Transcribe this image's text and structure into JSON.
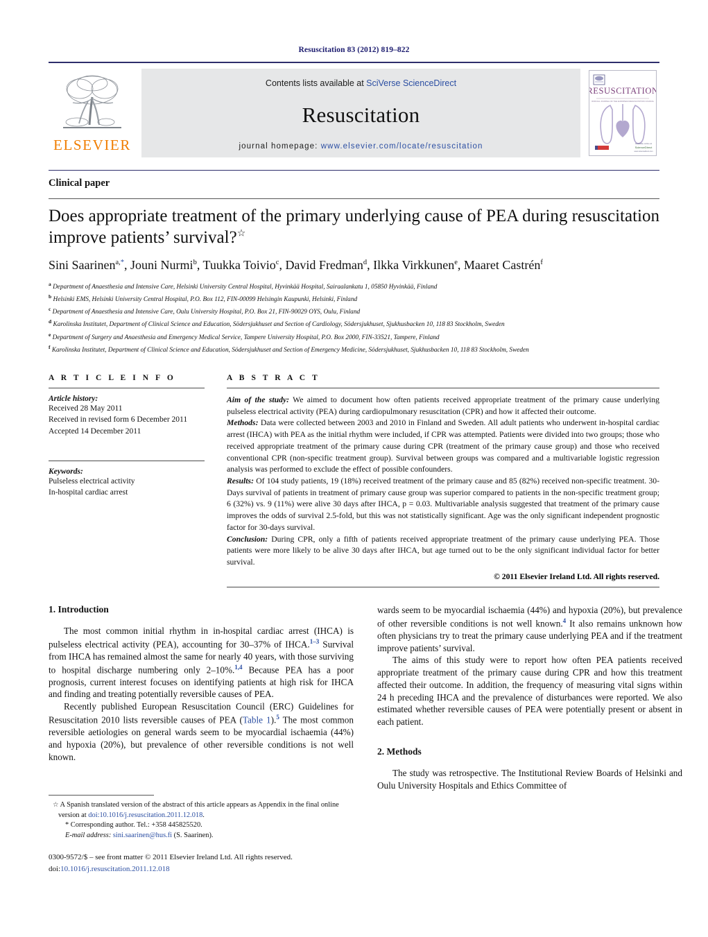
{
  "running_head": "Resuscitation 83 (2012) 819–822",
  "masthead": {
    "publisher_name": "ELSEVIER",
    "contents_prefix": "Contents lists available at ",
    "contents_link": "SciVerse ScienceDirect",
    "journal_name": "Resuscitation",
    "homepage_prefix": "journal homepage: ",
    "homepage_url": "www.elsevier.com/locate/resuscitation",
    "cover_title": "RESUSCITATION",
    "cover_subtitle": "OFFICIAL JOURNAL OF THE EUROPEAN RESUSCITATION COUNCIL"
  },
  "article": {
    "kicker": "Clinical paper",
    "title": "Does appropriate treatment of the primary underlying cause of PEA during resuscitation improve patients’ survival?",
    "title_star": "☆",
    "authors": "Sini Saarinen^a,*, Jouni Nurmi^b, Tuukka Toivio^c, David Fredman^d, Ilkka Virkkunen^e, Maaret Castrén^f",
    "affiliations": [
      {
        "mark": "a",
        "text": "Department of Anaesthesia and Intensive Care, Helsinki University Central Hospital, Hyvinkää Hospital, Sairaalankatu 1, 05850 Hyvinkää, Finland"
      },
      {
        "mark": "b",
        "text": "Helsinki EMS, Helsinki University Central Hospital, P.O. Box 112, FIN-00099 Helsingin Kaupunki, Helsinki, Finland"
      },
      {
        "mark": "c",
        "text": "Department of Anaesthesia and Intensive Care, Oulu University Hospital, P.O. Box 21, FIN-90029 OYS, Oulu, Finland"
      },
      {
        "mark": "d",
        "text": "Karolinska Institutet, Department of Clinical Science and Education, Södersjukhuset and Section of Cardiology, Södersjukhuset, Sjukhusbacken 10, 118 83 Stockholm, Sweden"
      },
      {
        "mark": "e",
        "text": "Department of Surgery and Anaesthesia and Emergency Medical Service, Tampere University Hospital, P.O. Box 2000, FIN-33521, Tampere, Finland"
      },
      {
        "mark": "f",
        "text": "Karolinska Institutet, Department of Clinical Science and Education, Södersjukhuset and Section of Emergency Medicine, Södersjukhuset, Sjukhusbacken 10, 118 83 Stockholm, Sweden"
      }
    ]
  },
  "article_info": {
    "heading": "A R T I C L E   I N F O",
    "history_label": "Article history:",
    "history": [
      "Received 28 May 2011",
      "Received in revised form 6 December 2011",
      "Accepted 14 December 2011"
    ],
    "keywords_label": "Keywords:",
    "keywords": [
      "Pulseless electrical activity",
      "In-hospital cardiac arrest"
    ]
  },
  "abstract": {
    "heading": "A B S T R A C T",
    "aim_label": "Aim of the study:",
    "aim_text": " We aimed to document how often patients received appropriate treatment of the primary cause underlying pulseless electrical activity (PEA) during cardiopulmonary resuscitation (CPR) and how it affected their outcome.",
    "methods_label": "Methods:",
    "methods_text": " Data were collected between 2003 and 2010 in Finland and Sweden. All adult patients who underwent in-hospital cardiac arrest (IHCA) with PEA as the initial rhythm were included, if CPR was attempted. Patients were divided into two groups; those who received appropriate treatment of the primary cause during CPR (treatment of the primary cause group) and those who received conventional CPR (non-specific treatment group). Survival between groups was compared and a multivariable logistic regression analysis was performed to exclude the effect of possible confounders.",
    "results_label": "Results:",
    "results_text": " Of 104 study patients, 19 (18%) received treatment of the primary cause and 85 (82%) received non-specific treatment. 30-Days survival of patients in treatment of primary cause group was superior compared to patients in the non-specific treatment group; 6 (32%) vs. 9 (11%) were alive 30 days after IHCA, p = 0.03. Multivariable analysis suggested that treatment of the primary cause improves the odds of survival 2.5-fold, but this was not statistically significant. Age was the only significant independent prognostic factor for 30-days survival.",
    "conclusion_label": "Conclusion:",
    "conclusion_text": " During CPR, only a fifth of patients received appropriate treatment of the primary cause underlying PEA. Those patients were more likely to be alive 30 days after IHCA, but age turned out to be the only significant individual factor for better survival.",
    "copyright": "© 2011 Elsevier Ireland Ltd. All rights reserved."
  },
  "body": {
    "introduction_heading": "1.  Introduction",
    "intro_p1": "The most common initial rhythm in in-hospital cardiac arrest (IHCA) is pulseless electrical activity (PEA), accounting for 30–37% of IHCA.",
    "intro_p1_ref1": "1–3",
    "intro_p1_b": " Survival from IHCA has remained almost the same for nearly 40 years, with those surviving to hospital discharge numbering only 2–10%.",
    "intro_p1_ref2": "1,4",
    "intro_p1_c": " Because PEA has a poor prognosis, current interest focuses on identifying patients at high risk for IHCA and finding and treating potentially reversible causes of PEA.",
    "intro_p2": "Recently published European Resuscitation Council (ERC) Guidelines for Resuscitation 2010 lists reversible causes of PEA (",
    "intro_p2_link": "Table 1",
    "intro_p2_b": ").",
    "intro_p2_ref": "5",
    "intro_p2_c": " The most common reversible aetiologies on general wards seem to be myocardial ischaemia (44%) and hypoxia (20%), but prevalence of other reversible conditions is not well known.",
    "intro_p2_ref2": "4",
    "intro_p2_d": " It also remains unknown how often physicians try to treat the primary cause underlying PEA and if the treatment improve patients’ survival.",
    "intro_p3": "The aims of this study were to report how often PEA patients received appropriate treatment of the primary cause during CPR and how this treatment affected their outcome. In addition, the frequency of measuring vital signs within 24 h preceding IHCA and the prevalence of disturbances were reported. We also estimated whether reversible causes of PEA were potentially present or absent in each patient.",
    "methods_heading": "2.  Methods",
    "methods_p1": "The study was retrospective. The Institutional Review Boards of Helsinki and Oulu University Hospitals and Ethics Committee of"
  },
  "footnotes": {
    "star_mark": "☆",
    "star_text": " A Spanish translated version of the abstract of this article appears as Appendix in the final online version at ",
    "star_doi": "doi:10.1016/j.resuscitation.2011.12.018",
    "star_tail": ".",
    "corr_mark": "*",
    "corr_text": " Corresponding author. Tel.: +358 445825520.",
    "email_label": "E-mail address:",
    "email": "sini.saarinen@hus.fi",
    "email_tail": " (S. Saarinen)."
  },
  "imprint": {
    "line1": "0300-9572/$ – see front matter © 2011 Elsevier Ireland Ltd. All rights reserved.",
    "doi_prefix": "doi:",
    "doi": "10.1016/j.resuscitation.2011.12.018"
  },
  "colors": {
    "header_blue": "#1a1a6e",
    "link_blue": "#2b4ea2",
    "elsevier_orange": "#f07d00",
    "masthead_grey": "#e6e7e8"
  }
}
